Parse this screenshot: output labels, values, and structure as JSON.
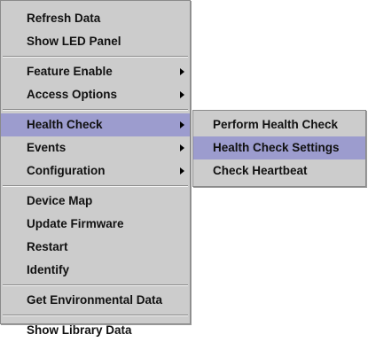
{
  "main_menu": {
    "group1": [
      "Refresh Data",
      "Show LED Panel"
    ],
    "group2": [
      "Feature Enable",
      "Access Options"
    ],
    "group3": [
      "Health Check",
      "Events",
      "Configuration"
    ],
    "group4": [
      "Device Map",
      "Update Firmware",
      "Restart",
      "Identify"
    ],
    "group5": [
      "Get Environmental Data"
    ],
    "group6": [
      "Show Library Data"
    ]
  },
  "health_check_submenu": {
    "items": [
      "Perform Health Check",
      "Health Check Settings",
      "Check Heartbeat"
    ]
  },
  "colors": {
    "menu_background": "#cccccc",
    "highlight": "#9c9cce",
    "text": "#111111"
  }
}
